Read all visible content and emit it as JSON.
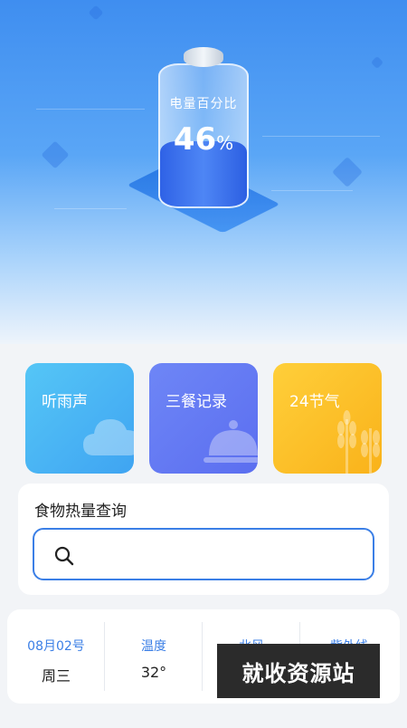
{
  "hero": {
    "battery_label": "电量百分比",
    "battery_value": "46",
    "battery_unit": "%",
    "battery_level": 0.46
  },
  "cards": [
    {
      "label": "听雨声",
      "icon": "cloud-icon"
    },
    {
      "label": "三餐记录",
      "icon": "food-cover-icon"
    },
    {
      "label": "24节气",
      "icon": "wheat-icon"
    }
  ],
  "search": {
    "title": "食物热量查询",
    "placeholder": "",
    "icon": "search-icon"
  },
  "info": {
    "date": "08月02号",
    "weekday": "周三",
    "temp_label": "温度",
    "temp_value": "32°",
    "wind_label": "北风",
    "uv_label": "紫外线"
  },
  "watermark": "就收资源站",
  "colors": {
    "accent": "#3b7fe6",
    "card_rain": "#4fb8f4",
    "card_meals": "#6678f2",
    "card_solar": "#fbbf28"
  }
}
